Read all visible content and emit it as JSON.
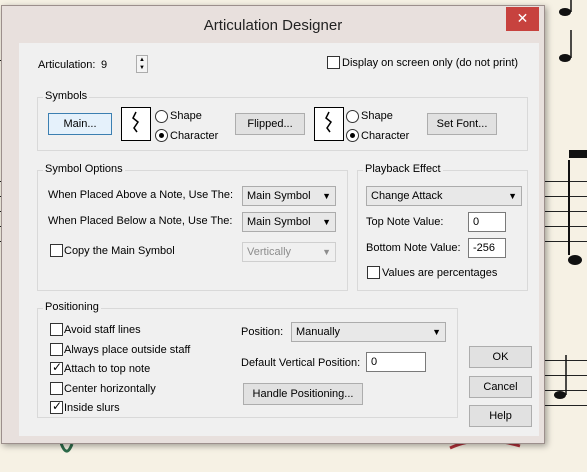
{
  "window": {
    "title": "Articulation Designer",
    "close_label": "✕"
  },
  "articulation": {
    "label": "Articulation:",
    "value": "9"
  },
  "display_screen_only": {
    "label": "Display on screen only (do not print)",
    "checked": false
  },
  "symbols": {
    "title": "Symbols",
    "main_button": "Main...",
    "flipped_button": "Flipped...",
    "set_font_button": "Set Font...",
    "main_shape_label": "Shape",
    "main_character_label": "Character",
    "flipped_shape_label": "Shape",
    "flipped_character_label": "Character",
    "main_selected": "Character",
    "flipped_selected": "Character"
  },
  "symbol_options": {
    "title": "Symbol Options",
    "above_label": "When Placed Above a Note, Use The:",
    "above_value": "Main Symbol",
    "below_label": "When Placed Below a Note, Use The:",
    "below_value": "Main Symbol",
    "copy_label": "Copy the Main Symbol",
    "copy_checked": false,
    "copy_direction": "Vertically"
  },
  "playback": {
    "title": "Playback Effect",
    "effect_value": "Change Attack",
    "top_note_label": "Top Note Value:",
    "top_note_value": "0",
    "bottom_note_label": "Bottom Note Value:",
    "bottom_note_value": "-256",
    "percent_label": "Values are percentages",
    "percent_checked": false
  },
  "positioning": {
    "title": "Positioning",
    "avoid_staff_label": "Avoid staff lines",
    "avoid_staff_checked": false,
    "outside_staff_label": "Always place outside staff",
    "outside_staff_checked": false,
    "attach_top_label": "Attach to top note",
    "attach_top_checked": true,
    "center_label": "Center horizontally",
    "center_checked": false,
    "inside_slurs_label": "Inside slurs",
    "inside_slurs_checked": true,
    "position_label": "Position:",
    "position_value": "Manually",
    "default_vertical_label": "Default Vertical Position:",
    "default_vertical_value": "0",
    "handle_button": "Handle Positioning..."
  },
  "actions": {
    "ok": "OK",
    "cancel": "Cancel",
    "help": "Help"
  },
  "colors": {
    "title_bg": "#e8e0dd",
    "client_bg": "#f0f0f0",
    "close_bg": "#c7423e",
    "focus_border": "#3c7fb1"
  }
}
